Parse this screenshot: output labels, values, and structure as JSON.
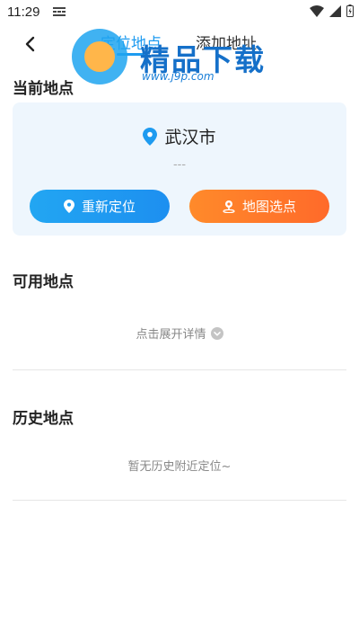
{
  "status_bar": {
    "time": "11:29"
  },
  "header": {
    "tabs": [
      {
        "label": "定位地点",
        "active": true
      },
      {
        "label": "添加地址",
        "active": false
      }
    ]
  },
  "watermark": {
    "brand": "精品下载",
    "url": "www.j9p.com"
  },
  "current": {
    "title": "当前地点",
    "city": "武汉市",
    "address": "---",
    "relocate_label": "重新定位",
    "map_pick_label": "地图选点"
  },
  "available": {
    "title": "可用地点",
    "expand_label": "点击展开详情"
  },
  "history": {
    "title": "历史地点",
    "empty_text": "暂无历史附近定位~"
  },
  "colors": {
    "accent": "#1e9bf0",
    "orange": "#ff7a2a",
    "card_bg": "#eef6fd"
  },
  "icons": [
    "back-arrow-icon",
    "location-pin-icon",
    "map-pin-icon",
    "chevron-down-icon",
    "wifi-icon",
    "signal-icon",
    "battery-icon",
    "notification-icon"
  ]
}
